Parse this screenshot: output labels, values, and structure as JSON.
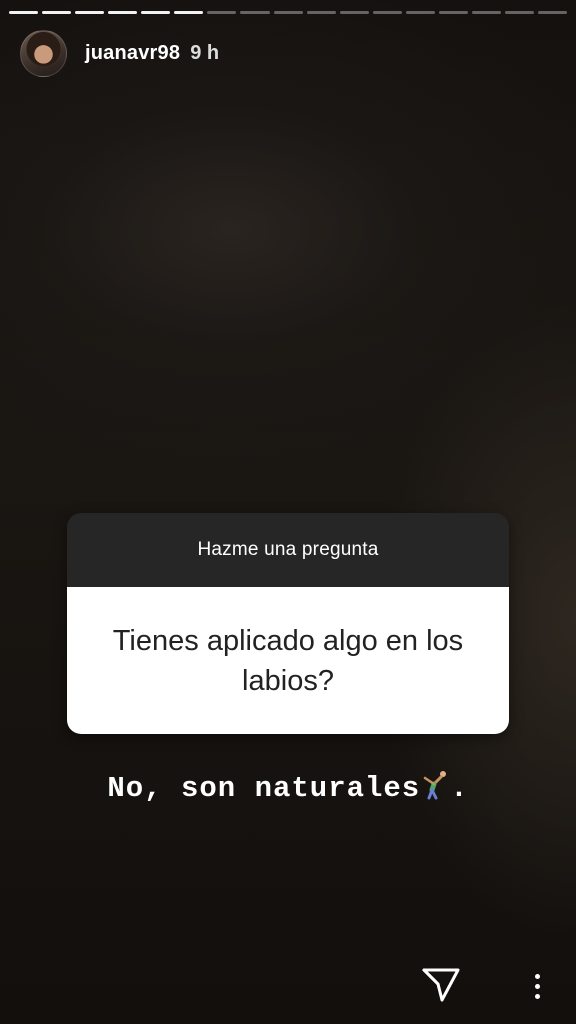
{
  "story": {
    "segments_total": 17,
    "segments_done": 6
  },
  "header": {
    "username": "juanavr98",
    "time": "9 h"
  },
  "question": {
    "title": "Hazme una pregunta",
    "text": "Tienes aplicado algo en los labios?"
  },
  "answer": {
    "text": "No, son naturales",
    "suffix": ".",
    "emoji": "person-cartwheeling-emoji"
  },
  "actions": {
    "send_icon": "send-direct-icon",
    "more_icon": "more-vertical-icon"
  },
  "colors": {
    "card_header_bg": "#262626",
    "card_body_bg": "#ffffff",
    "text_light": "#ffffff"
  }
}
